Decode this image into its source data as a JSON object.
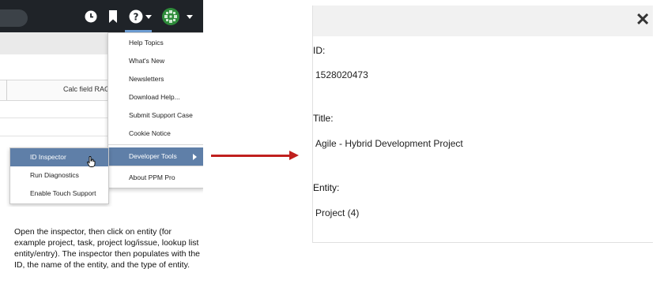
{
  "menu": {
    "help_items": [
      "Help Topics",
      "What's New",
      "Newsletters",
      "Download Help...",
      "Submit Support Case",
      "Cookie Notice",
      "Developer Tools",
      "About PPM Pro"
    ],
    "developer_tools_items": [
      "ID Inspector",
      "Run Diagnostics",
      "Enable Touch Support"
    ]
  },
  "grid": {
    "column_header": "Calc field RAG"
  },
  "caption": "Open the inspector, then click on entity (for example project, task, project log/issue, lookup list entity/entry). The inspector then populates with the ID, the name of the entity, and the type of entity.",
  "inspector": {
    "id_label": "ID:",
    "id_value": "1528020473",
    "title_label": "Title:",
    "title_value": "Agile - Hybrid Development Project",
    "entity_label": "Entity:",
    "entity_value": "Project (4)",
    "close_symbol": "✕"
  },
  "colors": {
    "topbar": "#1f2328",
    "menu_highlight": "#5f7fa8",
    "arrow": "#c0201e",
    "avatar": "#2e8b3a"
  },
  "icons": [
    "clock-icon",
    "bookmark-icon",
    "help-icon",
    "avatar-icon",
    "cursor-icon",
    "close-icon"
  ]
}
